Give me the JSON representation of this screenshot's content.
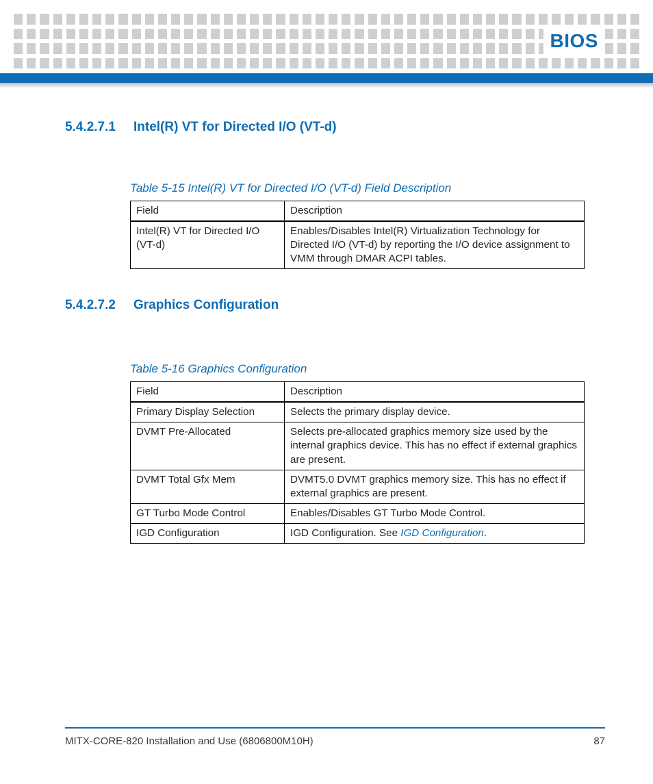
{
  "header": {
    "chapter": "BIOS"
  },
  "sec1": {
    "num": "5.4.2.7.1",
    "title": "Intel(R) VT for Directed I/O (VT-d)"
  },
  "table1": {
    "caption": "Table 5-15 Intel(R) VT for Directed I/O (VT-d) Field Description",
    "col1": "Field",
    "col2": "Description",
    "rows": [
      {
        "field": "Intel(R) VT for Directed I/O (VT-d)",
        "desc": "Enables/Disables Intel(R) Virtualization Technology for Directed I/O (VT-d) by reporting the I/O device assignment to VMM through DMAR ACPI tables."
      }
    ]
  },
  "sec2": {
    "num": "5.4.2.7.2",
    "title": "Graphics Configuration"
  },
  "table2": {
    "caption": "Table 5-16 Graphics Configuration",
    "col1": "Field",
    "col2": "Description",
    "rows": [
      {
        "field": "Primary Display Selection",
        "desc": "Selects the primary display device."
      },
      {
        "field": "DVMT Pre-Allocated",
        "desc": "Selects pre-allocated graphics memory size used by the internal graphics device. This has no effect if external graphics are present."
      },
      {
        "field": "DVMT Total Gfx Mem",
        "desc": "DVMT5.0 DVMT graphics memory size. This has no effect if external graphics are present."
      },
      {
        "field": "GT Turbo Mode Control",
        "desc": "Enables/Disables GT Turbo Mode Control."
      },
      {
        "field": "IGD Configuration",
        "desc_prefix": "IGD Configuration. See ",
        "link": "IGD Configuration",
        "desc_suffix": "."
      }
    ]
  },
  "footer": {
    "doc": "MITX-CORE-820 Installation and Use (6806800M10H)",
    "page": "87"
  }
}
